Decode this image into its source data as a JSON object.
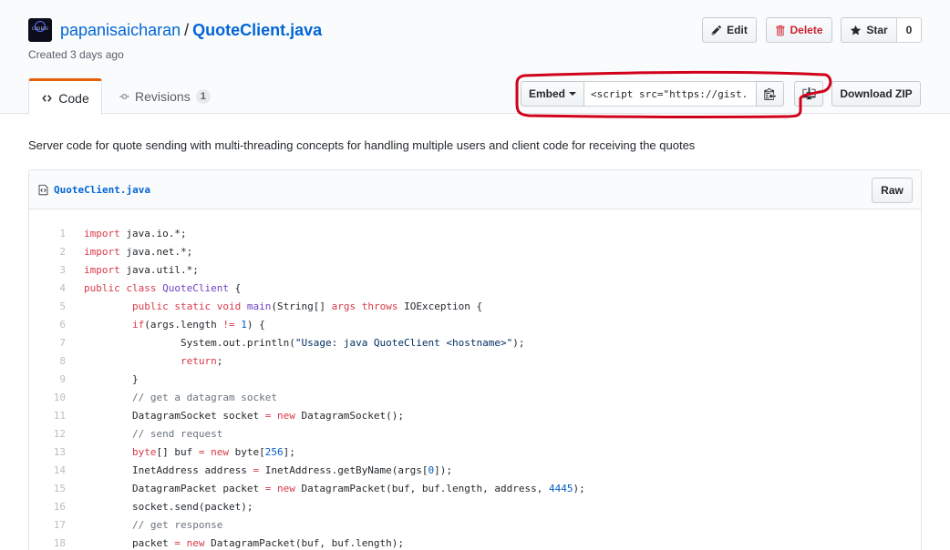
{
  "header": {
    "owner": "papanisaicharan",
    "separator": "/",
    "gist_name": "QuoteClient.java",
    "created": "Created 3 days ago",
    "avatar_text": "CODERS"
  },
  "actions": {
    "edit_label": "Edit",
    "delete_label": "Delete",
    "star_label": "Star",
    "star_count": "0"
  },
  "tabs": {
    "code_label": "Code",
    "revisions_label": "Revisions",
    "revisions_count": "1"
  },
  "embed": {
    "select_label": "Embed",
    "script_value": "<script src=\"https://gist."
  },
  "download": {
    "zip_label": "Download ZIP"
  },
  "description": "Server code for quote sending with multi-threading concepts for handling multiple users and client code for receiving the quotes",
  "file": {
    "name": "QuoteClient.java",
    "raw_label": "Raw",
    "lines": [
      {
        "n": "1",
        "indent": 0,
        "tokens": [
          [
            "k",
            "import"
          ],
          [
            "",
            "java.io.*;"
          ]
        ]
      },
      {
        "n": "2",
        "indent": 0,
        "tokens": [
          [
            "k",
            "import"
          ],
          [
            "",
            "java.net.*;"
          ]
        ]
      },
      {
        "n": "3",
        "indent": 0,
        "tokens": [
          [
            "k",
            "import"
          ],
          [
            "",
            "java.util.*;"
          ]
        ]
      },
      {
        "n": "4",
        "indent": 0,
        "tokens": [
          [
            "k",
            "public class"
          ],
          [
            "f",
            "QuoteClient"
          ],
          [
            "",
            "{"
          ]
        ]
      },
      {
        "n": "5",
        "indent": 1,
        "tokens": [
          [
            "k",
            "public static void"
          ],
          [
            "f",
            "main"
          ],
          [
            "",
            "(String[]"
          ],
          [
            "k",
            "args"
          ],
          [
            ",",
            " "
          ],
          [
            "k",
            "throws"
          ],
          [
            "",
            "IOException {"
          ]
        ]
      },
      {
        "n": "6",
        "indent": 1,
        "tokens": [
          [
            "k",
            "if"
          ],
          [
            "",
            "(args.length"
          ],
          [
            "k",
            "!="
          ],
          [
            "n",
            "1"
          ],
          [
            "",
            ") {"
          ]
        ]
      },
      {
        "n": "7",
        "indent": 2,
        "tokens": [
          [
            "",
            "System.out.println("
          ],
          [
            "s",
            "\"Usage: java QuoteClient <hostname>\""
          ],
          [
            "",
            ");"
          ]
        ]
      },
      {
        "n": "8",
        "indent": 2,
        "tokens": [
          [
            "k",
            "return"
          ],
          [
            "",
            ";"
          ]
        ]
      },
      {
        "n": "9",
        "indent": 1,
        "tokens": [
          [
            "",
            "}"
          ]
        ]
      },
      {
        "n": "10",
        "indent": 1,
        "tokens": [
          [
            "c",
            "// get a datagram socket"
          ]
        ]
      },
      {
        "n": "11",
        "indent": 1,
        "tokens": [
          [
            "",
            "DatagramSocket socket"
          ],
          [
            "k",
            "="
          ],
          [
            "k",
            "new"
          ],
          [
            "",
            "DatagramSocket();"
          ]
        ]
      },
      {
        "n": "12",
        "indent": 1,
        "tokens": [
          [
            "c",
            "// send request"
          ]
        ]
      },
      {
        "n": "13",
        "indent": 1,
        "tokens": [
          [
            "k",
            "byte"
          ],
          [
            "",
            "[] buf"
          ],
          [
            "k",
            "="
          ],
          [
            "k",
            "new"
          ],
          [
            "",
            "byte["
          ],
          [
            "n",
            "256"
          ],
          [
            "",
            "];"
          ]
        ]
      },
      {
        "n": "14",
        "indent": 1,
        "tokens": [
          [
            "",
            "InetAddress address"
          ],
          [
            "k",
            "="
          ],
          [
            "",
            "InetAddress.getByName(args["
          ],
          [
            "n",
            "0"
          ],
          [
            "",
            "]);"
          ]
        ]
      },
      {
        "n": "15",
        "indent": 1,
        "tokens": [
          [
            "",
            "DatagramPacket packet"
          ],
          [
            "k",
            "="
          ],
          [
            "k",
            "new"
          ],
          [
            "",
            "DatagramPacket(buf, buf.length, address,"
          ],
          [
            "n",
            "4445"
          ],
          [
            "",
            ");"
          ]
        ]
      },
      {
        "n": "16",
        "indent": 1,
        "tokens": [
          [
            "",
            "socket.send(packet);"
          ]
        ]
      },
      {
        "n": "17",
        "indent": 1,
        "tokens": [
          [
            "c",
            "// get response"
          ]
        ]
      },
      {
        "n": "18",
        "indent": 1,
        "tokens": [
          [
            "",
            "packet"
          ],
          [
            "k",
            "="
          ],
          [
            "k",
            "new"
          ],
          [
            "",
            "DatagramPacket(buf, buf.length);"
          ]
        ]
      }
    ]
  },
  "colors": {
    "link": "#0366d6",
    "tab_accent": "#e36209",
    "delete": "#cb2431",
    "annotation": "#d0021b"
  }
}
